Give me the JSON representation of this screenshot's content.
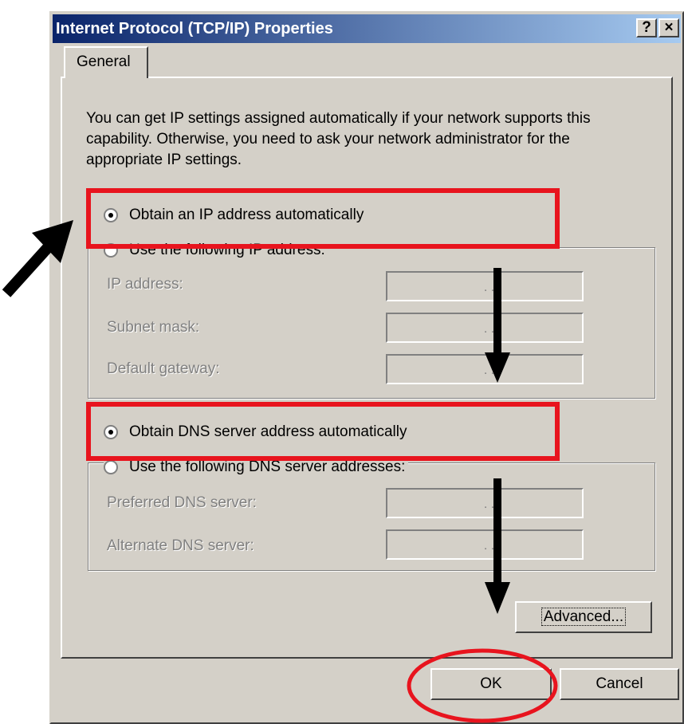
{
  "window": {
    "title": "Internet Protocol (TCP/IP) Properties",
    "help_label": "?",
    "close_label": "×"
  },
  "tabs": [
    {
      "label": "General"
    }
  ],
  "intro_text": "You can get IP settings assigned automatically if your network supports this capability. Otherwise, you need to ask your network administrator for the appropriate IP settings.",
  "ip_section": {
    "auto_label": "Obtain an IP address automatically",
    "manual_label": "Use the following IP address:",
    "fields": [
      {
        "label": "IP address:",
        "value": ". . ."
      },
      {
        "label": "Subnet mask:",
        "value": ". . ."
      },
      {
        "label": "Default gateway:",
        "value": ". . ."
      }
    ]
  },
  "dns_section": {
    "auto_label": "Obtain DNS server address automatically",
    "manual_label": "Use the following DNS server addresses:",
    "fields": [
      {
        "label": "Preferred DNS server:",
        "value": ". . ."
      },
      {
        "label": "Alternate DNS server:",
        "value": ". . ."
      }
    ]
  },
  "buttons": {
    "advanced": "Advanced...",
    "ok": "OK",
    "cancel": "Cancel"
  },
  "annotations": {
    "highlight_color": "#e8141e",
    "arrow_color": "#000000"
  }
}
